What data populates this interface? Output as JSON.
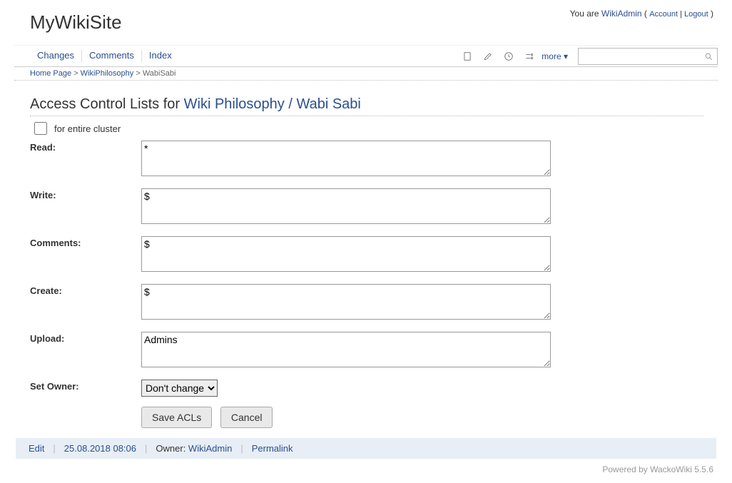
{
  "user": {
    "prefix": "You are ",
    "name": "WikiAdmin",
    "account": "Account",
    "logout": "Logout"
  },
  "site": {
    "title": "MyWikiSite"
  },
  "nav": {
    "changes": "Changes",
    "comments": "Comments",
    "index": "Index",
    "more": "more ▾"
  },
  "breadcrumb": {
    "home": "Home Page",
    "sep": ">",
    "l2": "WikiPhilosophy",
    "current": "WabiSabi"
  },
  "acl": {
    "heading_prefix": "Access Control Lists for ",
    "page_link": "Wiki Philosophy / Wabi Sabi",
    "cluster_label": "for entire cluster",
    "fields": {
      "read": {
        "label": "Read:",
        "value": "*"
      },
      "write": {
        "label": "Write:",
        "value": "$"
      },
      "comments": {
        "label": "Comments:",
        "value": "$"
      },
      "create": {
        "label": "Create:",
        "value": "$"
      },
      "upload": {
        "label": "Upload:",
        "value": "Admins"
      }
    },
    "owner": {
      "label": "Set Owner:",
      "selected": "Don't change"
    },
    "buttons": {
      "save": "Save ACLs",
      "cancel": "Cancel"
    }
  },
  "footer": {
    "edit": "Edit",
    "timestamp": "25.08.2018 08:06",
    "owner_label": "Owner: ",
    "owner_link": "WikiAdmin",
    "permalink": "Permalink"
  },
  "powered": "Powered by WackoWiki 5.5.6"
}
